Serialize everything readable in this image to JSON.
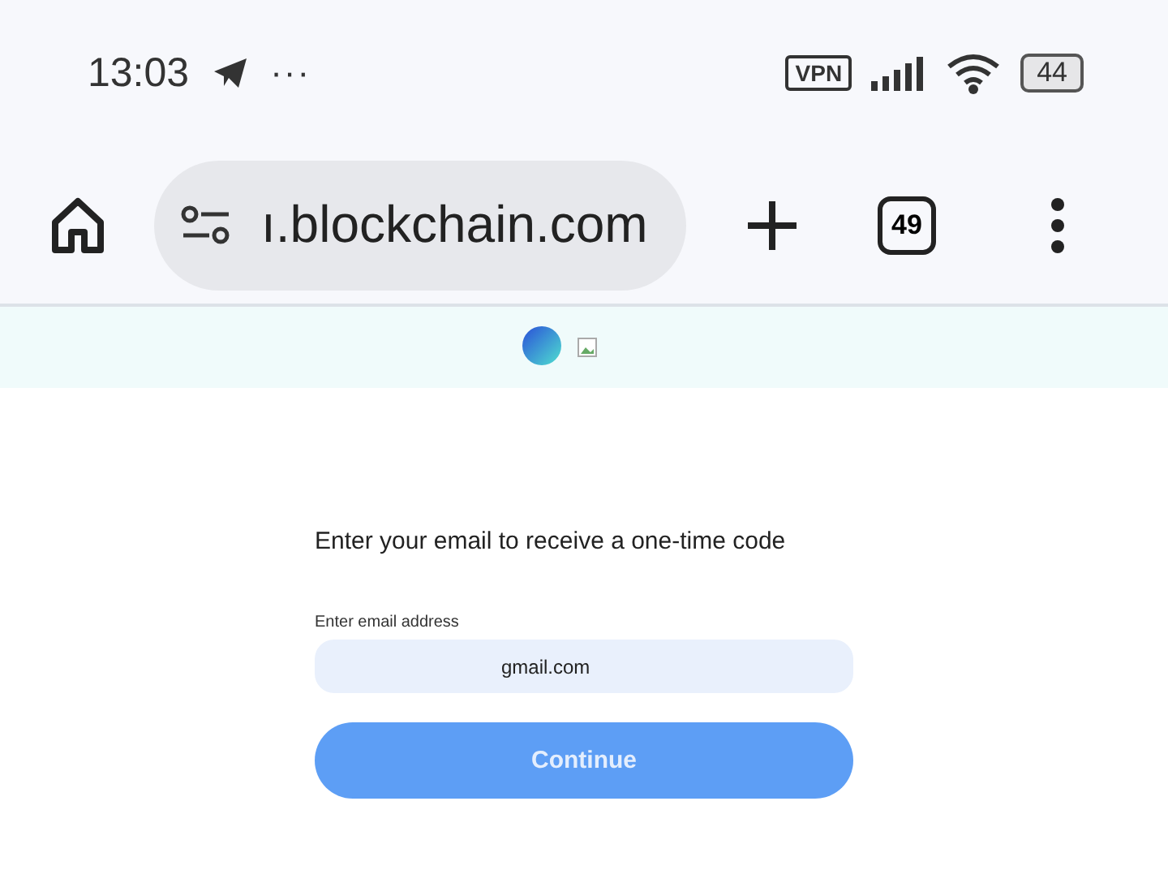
{
  "status_bar": {
    "time": "13:03",
    "more": "···",
    "vpn": "VPN",
    "battery": "44"
  },
  "browser": {
    "url": "ı.blockchain.com",
    "tab_count": "49"
  },
  "form": {
    "heading": "Enter your email to receive a one-time code",
    "email_label": "Enter email address",
    "email_value": "gmail.com",
    "button": {
      "label": "Continue",
      "disabled": true
    }
  }
}
